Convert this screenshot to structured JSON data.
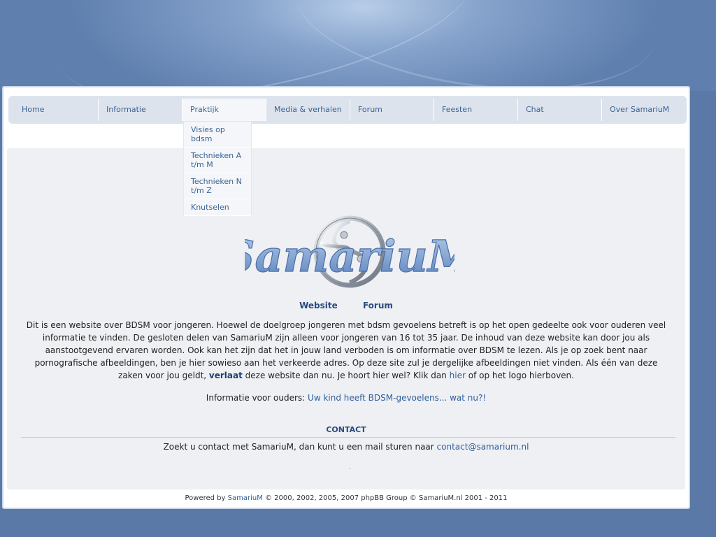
{
  "nav": {
    "items": [
      {
        "label": "Home"
      },
      {
        "label": "Informatie"
      },
      {
        "label": "Praktijk"
      },
      {
        "label": "Media & verhalen"
      },
      {
        "label": "Forum"
      },
      {
        "label": "Feesten"
      },
      {
        "label": "Chat"
      },
      {
        "label": "Over SamariuM"
      }
    ],
    "dropdown": [
      {
        "label": "Visies op bdsm"
      },
      {
        "label": "Technieken A t/m M"
      },
      {
        "label": "Technieken N t/m Z"
      },
      {
        "label": "Knutselen"
      }
    ]
  },
  "logo": {
    "text": "SamariuM",
    "icon": "yin-yang-triskele-icon"
  },
  "links": {
    "website": "Website",
    "forum": "Forum"
  },
  "intro": {
    "text1": "Dit is een website over BDSM voor jongeren. Hoewel de doelgroep jongeren met bdsm gevoelens betreft is op het open gedeelte ook voor ouderen veel informatie te vinden. De gesloten delen van SamariuM zijn alleen voor jongeren van 16 tot 35 jaar. De inhoud van deze website kan door jou als aanstootgevend ervaren worden. Ook kan het zijn dat het in jouw land verboden is om informatie over BDSM te lezen. Als je op zoek bent naar pornografische afbeeldingen, ben je hier sowieso aan het verkeerde adres. Op deze site zul je dergelijke afbeeldingen niet vinden. Als één van deze zaken voor jou geldt, ",
    "leave_link": "verlaat",
    "text2": " deze website dan nu. Je hoort hier wel? Klik dan ",
    "here_link": "hier",
    "text3": " of op het logo hierboven."
  },
  "parents": {
    "label": "Informatie voor ouders: ",
    "link": "Uw kind heeft BDSM-gevoelens... wat nu?!"
  },
  "contact": {
    "title": "CONTACT",
    "text": "Zoekt u contact met SamariuM, dan kunt u een mail sturen naar ",
    "email": "contact@samarium.nl",
    "dot": "."
  },
  "footer": {
    "prefix": "Powered by ",
    "brand": "SamariuM",
    "suffix": " © 2000, 2002, 2005, 2007 phpBB Group © SamariuM.nl 2001 - 2011"
  },
  "colors": {
    "background": "#5a79a6",
    "nav_bg": "#dde3ec",
    "link": "#3b6395",
    "content_bg": "#eef0f3"
  }
}
